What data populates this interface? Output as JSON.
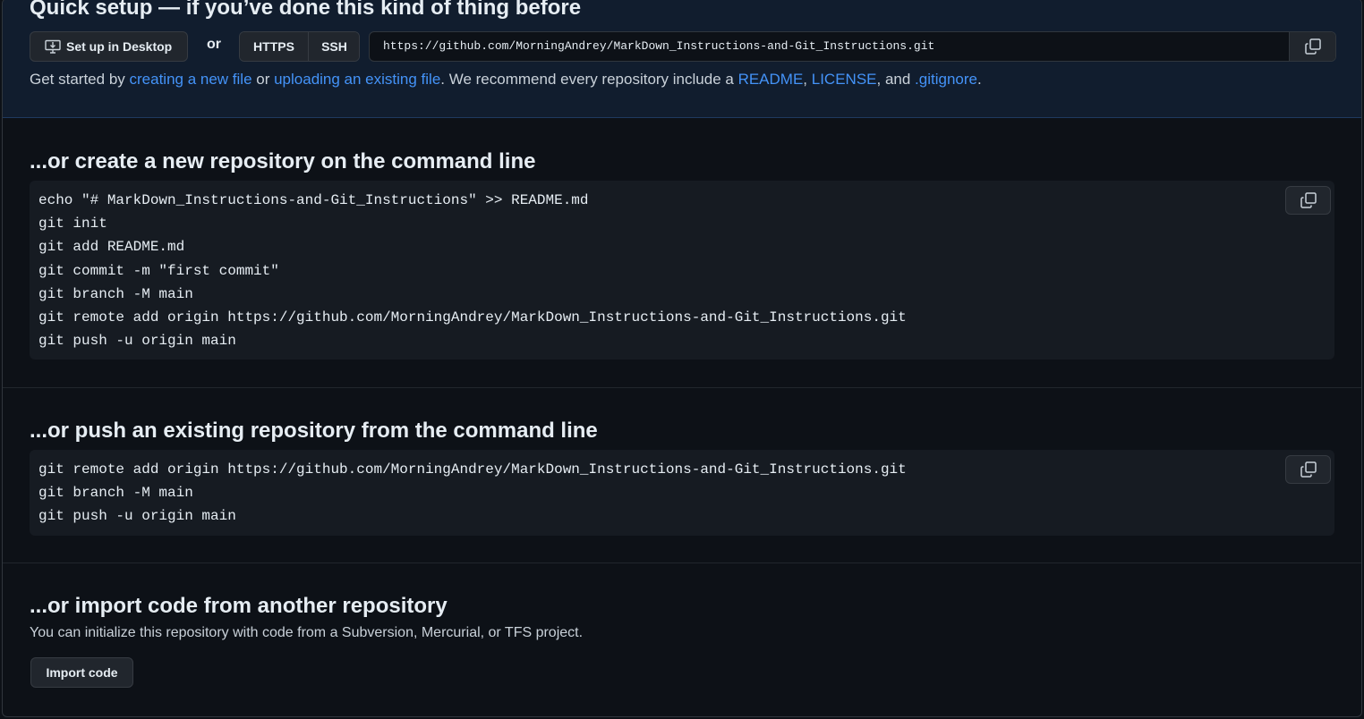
{
  "quick_setup": {
    "title": "Quick setup — if you’ve done this kind of thing before",
    "desktop_button": "Set up in Desktop",
    "or_label": "or",
    "protocols": {
      "https": "HTTPS",
      "ssh": "SSH"
    },
    "clone_url": "https://github.com/MorningAndrey/MarkDown_Instructions-and-Git_Instructions.git",
    "get_started": {
      "prefix": "Get started by ",
      "link_new_file": "creating a new file",
      "or": " or ",
      "link_upload": "uploading an existing file",
      "middle": ". We recommend every repository include a ",
      "link_readme": "README",
      "comma1": ", ",
      "link_license": "LICENSE",
      "and": ", and ",
      "link_gitignore": ".gitignore",
      "end": "."
    }
  },
  "new_repo": {
    "title": "...or create a new repository on the command line",
    "code": "echo \"# MarkDown_Instructions-and-Git_Instructions\" >> README.md\ngit init\ngit add README.md\ngit commit -m \"first commit\"\ngit branch -M main\ngit remote add origin https://github.com/MorningAndrey/MarkDown_Instructions-and-Git_Instructions.git\ngit push -u origin main"
  },
  "push_existing": {
    "title": "...or push an existing repository from the command line",
    "code": "git remote add origin https://github.com/MorningAndrey/MarkDown_Instructions-and-Git_Instructions.git\ngit branch -M main\ngit push -u origin main"
  },
  "import": {
    "title": "...or import code from another repository",
    "description": "You can initialize this repository with code from a Subversion, Mercurial, or TFS project.",
    "button": "Import code"
  },
  "icons": {
    "desktop": "desktop-download-icon",
    "copy": "copy-icon"
  },
  "colors": {
    "background": "#0d1117",
    "quick_setup_bg": "#111d2e",
    "link": "#4493f8",
    "code_bg": "#161b22",
    "button_bg": "#21262d"
  }
}
